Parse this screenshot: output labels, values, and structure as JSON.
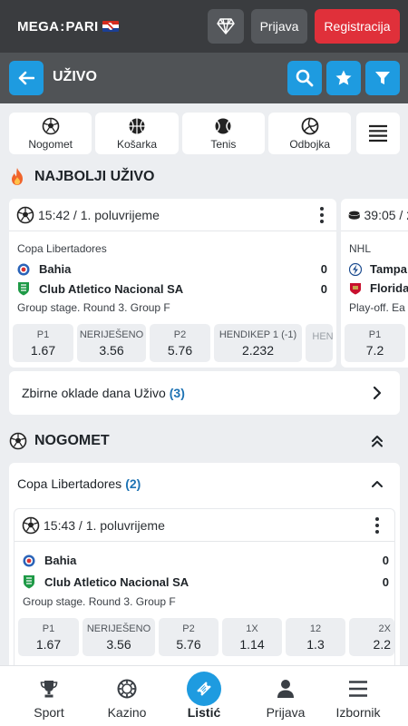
{
  "brand": {
    "part1": "MEGA",
    "separator": ":",
    "part2": "PARI"
  },
  "topbar": {
    "login_label": "Prijava",
    "register_label": "Registracija"
  },
  "header": {
    "title": "UŽIVO"
  },
  "sports_tabs": [
    {
      "label": "Nogomet",
      "icon": "football-icon"
    },
    {
      "label": "Košarka",
      "icon": "basketball-icon"
    },
    {
      "label": "Tenis",
      "icon": "tennis-icon"
    },
    {
      "label": "Odbojka",
      "icon": "volleyball-icon"
    }
  ],
  "top_live": {
    "title": "NAJBOLJI UŽIVO",
    "cards": [
      {
        "time": "15:42 / 1. poluvrijeme",
        "league": "Copa Libertadores",
        "team1": "Bahia",
        "score1": "0",
        "team2": "Club Atletico Nacional SA",
        "score2": "0",
        "stage": "Group stage. Round 3. Group F",
        "odds": [
          {
            "label": "P1",
            "value": "1.67"
          },
          {
            "label": "NERIJEŠENO",
            "value": "3.56"
          },
          {
            "label": "P2",
            "value": "5.76"
          },
          {
            "label": "HENDIKEP 1 (-1)",
            "value": "2.232"
          },
          {
            "label": "HEN",
            "value": ""
          }
        ]
      },
      {
        "time": "39:05 / 2",
        "league": "NHL",
        "team1": "Tampa",
        "team2": "Florida",
        "stage": "Play-off. Ea",
        "odds": [
          {
            "label": "P1",
            "value": "7.2"
          }
        ]
      }
    ]
  },
  "daily_bets": {
    "label": "Zbirne oklade dana Uživo",
    "count": "(3)"
  },
  "football_section": {
    "title": "NOGOMET",
    "group": {
      "name": "Copa Libertadores",
      "count": "(2)"
    },
    "match": {
      "time": "15:43 / 1. poluvrijeme",
      "team1": "Bahia",
      "score1": "0",
      "team2": "Club Atletico Nacional SA",
      "score2": "0",
      "stage": "Group stage. Round 3. Group F",
      "odds": [
        {
          "label": "P1",
          "value": "1.67"
        },
        {
          "label": "NERIJEŠENO",
          "value": "3.56"
        },
        {
          "label": "P2",
          "value": "5.76"
        },
        {
          "label": "1X",
          "value": "1.14"
        },
        {
          "label": "12",
          "value": "1.3"
        },
        {
          "label": "2X",
          "value": "2.2"
        }
      ]
    }
  },
  "bottom_nav": [
    {
      "label": "Sport",
      "icon": "trophy-icon"
    },
    {
      "label": "Kazino",
      "icon": "casino-chip-icon"
    },
    {
      "label": "Listić",
      "icon": "ticket-icon"
    },
    {
      "label": "Prijava",
      "icon": "user-icon"
    },
    {
      "label": "Izbornik",
      "icon": "menu-icon"
    }
  ],
  "colors": {
    "accent": "#1e9be0",
    "register": "#e0303a",
    "topbar": "#3a3c3f",
    "header": "#505356",
    "count": "#1e73b4"
  }
}
